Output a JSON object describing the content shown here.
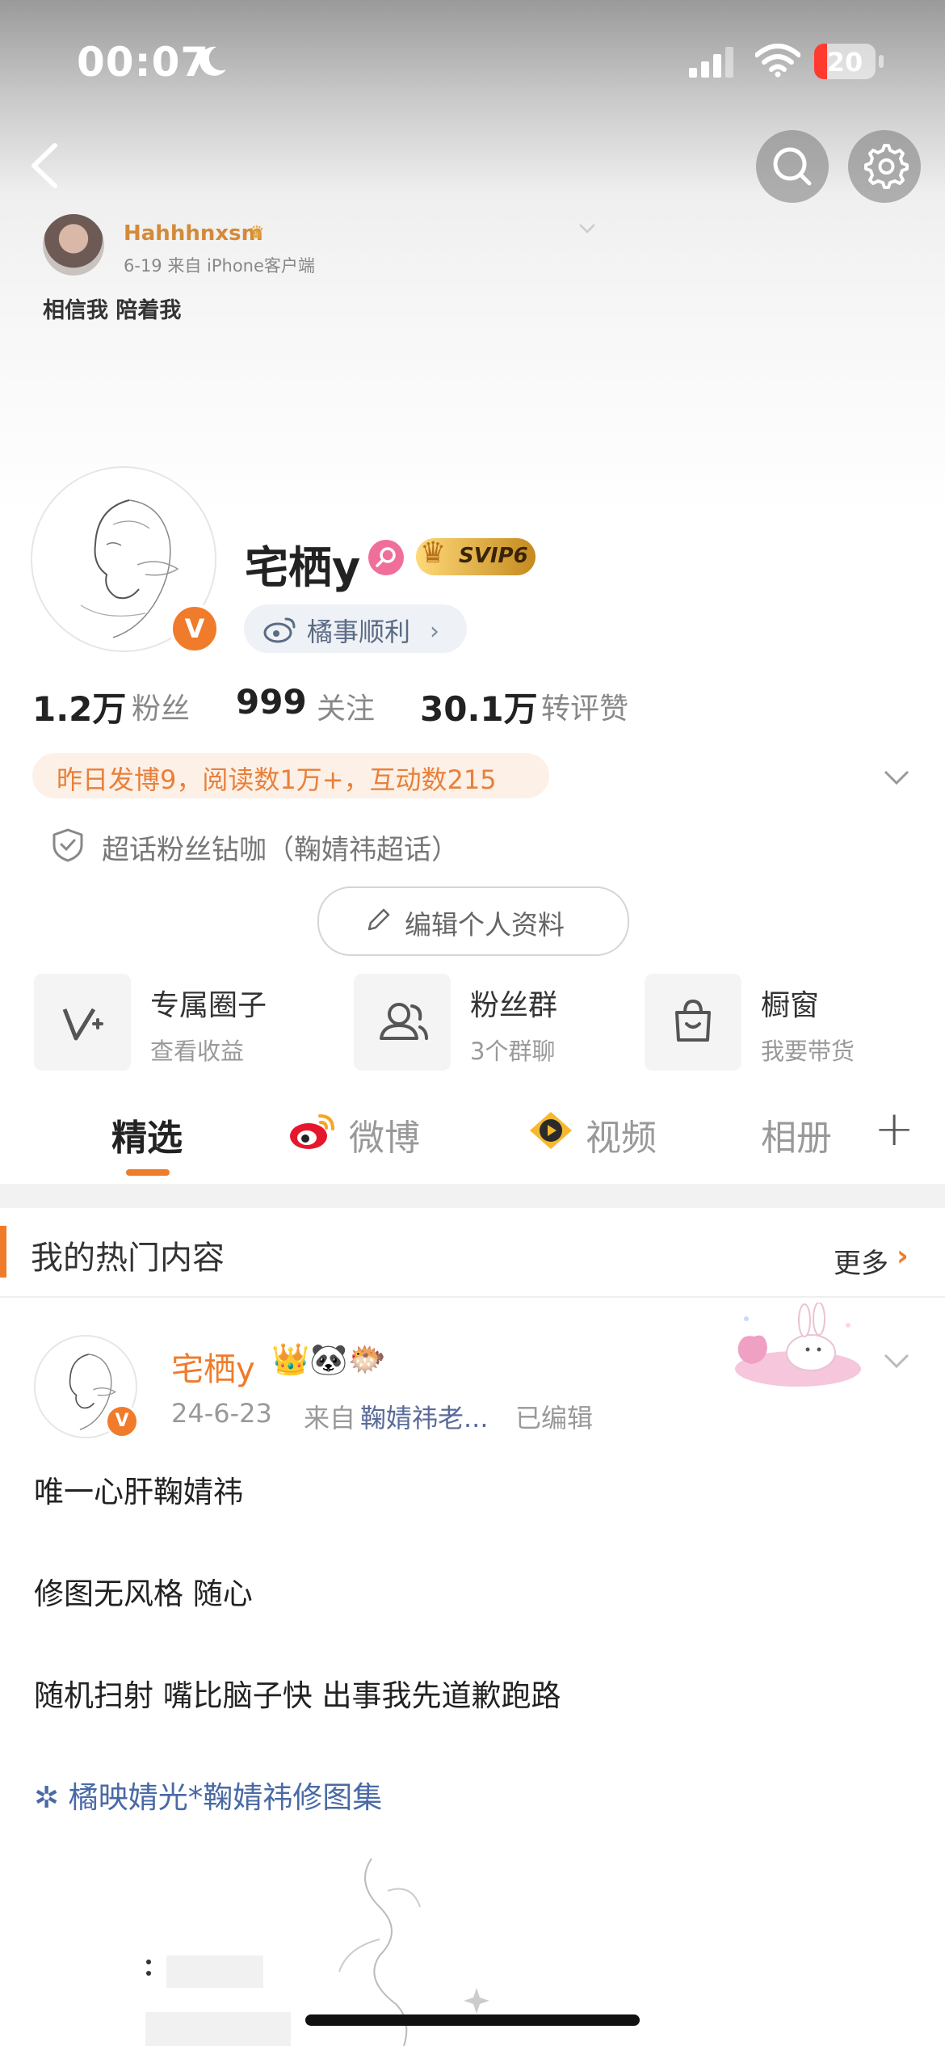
{
  "status_bar": {
    "time": "00:07",
    "battery": "20",
    "icons": [
      "moon-icon",
      "signal-icon",
      "wifi-icon",
      "battery-icon"
    ]
  },
  "nav": {
    "icons": [
      "back-icon",
      "search-icon",
      "gear-icon"
    ]
  },
  "background_post": {
    "username": "Hahhhnxsm",
    "meta": "6-19  来自 iPhone客户端",
    "text": "相信我 陪着我"
  },
  "profile": {
    "name": "宅栖y",
    "badge": "SVIP6",
    "verified": "V",
    "tag": "橘事顺利",
    "tag_chevron": "›"
  },
  "stats": [
    {
      "value": "1.2万",
      "label": "粉丝"
    },
    {
      "value": "999",
      "label": "关注"
    },
    {
      "value": "30.1万",
      "label": "转评赞"
    }
  ],
  "activity": "昨日发博9，阅读数1万+，互动数215",
  "superfan": "超话粉丝钻咖（鞠婧祎超话）",
  "edit_profile": "编辑个人资料",
  "features": [
    {
      "title": "专属圈子",
      "subtitle": "查看收益"
    },
    {
      "title": "粉丝群",
      "subtitle": "3个群聊"
    },
    {
      "title": "橱窗",
      "subtitle": "我要带货"
    }
  ],
  "tabs": {
    "featured": "精选",
    "weibo": "微博",
    "video": "视频",
    "album": "相册",
    "add": "+"
  },
  "hot": {
    "title": "我的热门内容",
    "more": "更多",
    "more_chevron": "›"
  },
  "post": {
    "username": "宅栖y",
    "emojis": "👑🐼🐡",
    "date": "24-6-23",
    "source_label": "来自",
    "source": "鞠婧祎老...",
    "edited": "已编辑",
    "lines": [
      "唯一心肝鞠婧祎",
      "修图无风格 随心",
      "随机扫射 嘴比脑子快 出事我先道歉跑路"
    ],
    "link": "✲ 橘映婧光*鞠婧祎修图集"
  },
  "colors": {
    "accent": "#f07b2a",
    "link": "#4a6aa5"
  }
}
